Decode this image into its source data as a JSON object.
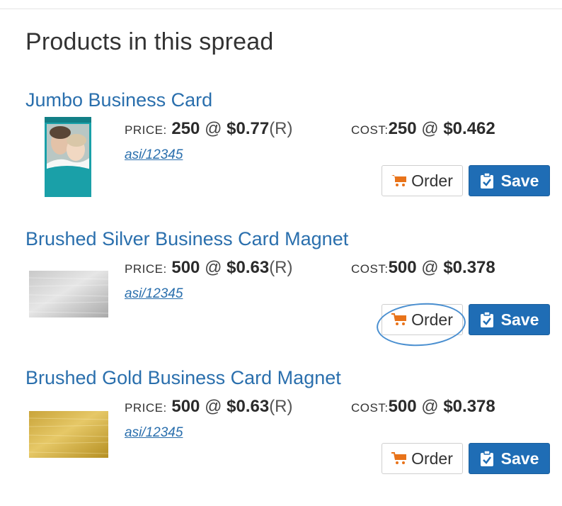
{
  "section_title": "Products in this spread",
  "labels": {
    "price": "PRICE:",
    "cost": "COST:",
    "at": "@",
    "order": "Order",
    "save": "Save"
  },
  "colors": {
    "link": "#2a6fad",
    "save_button": "#1f6db5",
    "cart_icon": "#e8731a",
    "annotation_circle": "#4a8fd0"
  },
  "products": [
    {
      "name": "Jumbo Business Card",
      "price_qty": "250",
      "price_each": "$0.77",
      "price_code": "(R)",
      "cost_qty": "250",
      "cost_each": "$0.462",
      "asi": "asi/12345"
    },
    {
      "name": "Brushed Silver Business Card Magnet",
      "price_qty": "500",
      "price_each": "$0.63",
      "price_code": "(R)",
      "cost_qty": "500",
      "cost_each": "$0.378",
      "asi": "asi/12345"
    },
    {
      "name": "Brushed Gold Business Card Magnet",
      "price_qty": "500",
      "price_each": "$0.63",
      "price_code": "(R)",
      "cost_qty": "500",
      "cost_each": "$0.378",
      "asi": "asi/12345"
    }
  ]
}
